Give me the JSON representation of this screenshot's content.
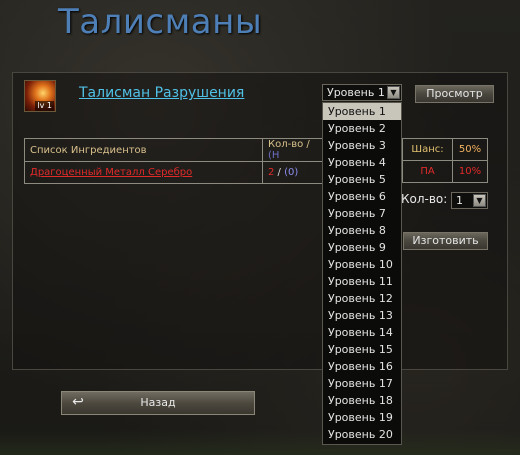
{
  "window": {
    "title": "Талисманы"
  },
  "talisman": {
    "name": "Талисман Разрушения",
    "icon": "fire-talisman-icon",
    "icon_level": "lv 1"
  },
  "level_select": {
    "selected": "Уровень 1",
    "options": [
      "Уровень 1",
      "Уровень 2",
      "Уровень 3",
      "Уровень 4",
      "Уровень 5",
      "Уровень 6",
      "Уровень 7",
      "Уровень 8",
      "Уровень 9",
      "Уровень 10",
      "Уровень 11",
      "Уровень 12",
      "Уровень 13",
      "Уровень 14",
      "Уровень 15",
      "Уровень 16",
      "Уровень 17",
      "Уровень 18",
      "Уровень 19",
      "Уровень 20"
    ]
  },
  "buttons": {
    "view": "Просмотр",
    "craft": "Изготовить",
    "back": "Назад"
  },
  "ingredients": {
    "header_name": "Список Ингредиентов",
    "header_qty": "Кол-во /",
    "header_qty_paren": "(Н",
    "rows": [
      {
        "name": "Драгоценный Металл Серебро",
        "have": "2",
        "sep": " / ",
        "need": "(0)"
      }
    ]
  },
  "chance": {
    "label": "Шанс:",
    "value": "50%",
    "pa_label": "ПА",
    "pa_value": "10%"
  },
  "quantity": {
    "label": "Кол-во:",
    "value": "1"
  },
  "colors": {
    "title": "#4e7fb6",
    "link": "#4fc0e6",
    "ingredient": "#e02a2a"
  }
}
